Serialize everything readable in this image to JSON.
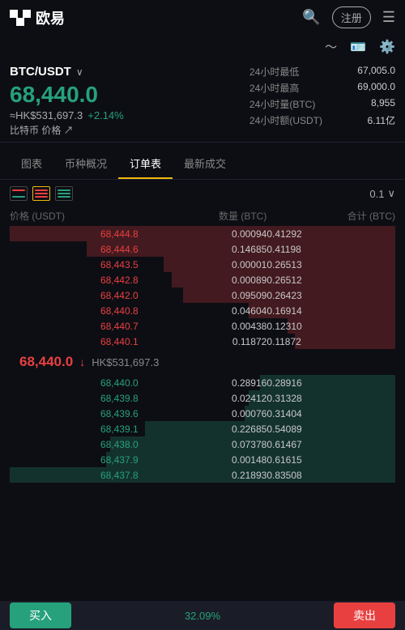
{
  "header": {
    "logo_text": "欧易",
    "register_label": "注册",
    "icons": [
      "search",
      "register",
      "menu"
    ]
  },
  "sub_header": {
    "icons": [
      "chart-line",
      "card",
      "gear"
    ]
  },
  "pair": {
    "name": "BTC/USDT",
    "price": "68,440.0",
    "hk_price": "≈HK$531,697.3",
    "change": "+2.14%",
    "link_label": "比特币 价格 ↗",
    "stats": [
      {
        "label": "24小时最低",
        "value": "67,005.0"
      },
      {
        "label": "24小时最高",
        "value": "69,000.0"
      },
      {
        "label": "24小时量(BTC)",
        "value": "8,955"
      },
      {
        "label": "24小时额(USDT)",
        "value": "6.11亿"
      }
    ]
  },
  "tabs": [
    {
      "label": "图表",
      "active": false
    },
    {
      "label": "币种概况",
      "active": false
    },
    {
      "label": "订单表",
      "active": true
    },
    {
      "label": "最新成交",
      "active": false
    }
  ],
  "orderbook": {
    "precision": "0.1",
    "header": [
      "价格 (USDT)",
      "数量 (BTC)",
      "合计 (BTC)"
    ],
    "asks": [
      {
        "price": "68,444.8",
        "amount": "0.00094",
        "total": "0.41292",
        "bar_pct": 100
      },
      {
        "price": "68,444.6",
        "amount": "0.14685",
        "total": "0.41198",
        "bar_pct": 80
      },
      {
        "price": "68,443.5",
        "amount": "0.00001",
        "total": "0.26513",
        "bar_pct": 60
      },
      {
        "price": "68,442.8",
        "amount": "0.00089",
        "total": "0.26512",
        "bar_pct": 58
      },
      {
        "price": "68,442.0",
        "amount": "0.09509",
        "total": "0.26423",
        "bar_pct": 55
      },
      {
        "price": "68,440.8",
        "amount": "0.04604",
        "total": "0.16914",
        "bar_pct": 38
      },
      {
        "price": "68,440.7",
        "amount": "0.00438",
        "total": "0.12310",
        "bar_pct": 28
      },
      {
        "price": "68,440.1",
        "amount": "0.11872",
        "total": "0.11872",
        "bar_pct": 26
      }
    ],
    "mid_price": "68,440.0",
    "mid_arrow": "↓",
    "mid_hk": "HK$531,697.3",
    "bids": [
      {
        "price": "68,440.0",
        "amount": "0.28916",
        "total": "0.28916",
        "bar_pct": 35
      },
      {
        "price": "68,439.8",
        "amount": "0.02412",
        "total": "0.31328",
        "bar_pct": 38
      },
      {
        "price": "68,439.6",
        "amount": "0.00076",
        "total": "0.31404",
        "bar_pct": 39
      },
      {
        "price": "68,439.1",
        "amount": "0.22685",
        "total": "0.54089",
        "bar_pct": 65
      },
      {
        "price": "68,438.0",
        "amount": "0.07378",
        "total": "0.61467",
        "bar_pct": 74
      },
      {
        "price": "68,437.9",
        "amount": "0.00148",
        "total": "0.61615",
        "bar_pct": 75
      },
      {
        "price": "68,437.8",
        "amount": "0.21893",
        "total": "0.83508",
        "bar_pct": 100
      }
    ]
  },
  "bottom": {
    "buy_label": "买入",
    "sell_label": "卖出",
    "pct_label": "32.09%"
  }
}
